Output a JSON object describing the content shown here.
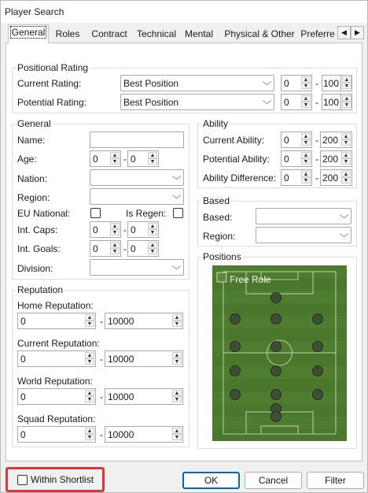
{
  "window": {
    "title": "Player Search"
  },
  "tabs": [
    {
      "label": "General",
      "active": true
    },
    {
      "label": "Roles"
    },
    {
      "label": "Contract"
    },
    {
      "label": "Technical"
    },
    {
      "label": "Mental"
    },
    {
      "label": "Physical & Other"
    },
    {
      "label": "Preferre"
    }
  ],
  "positional_rating": {
    "title": "Positional Rating",
    "current": {
      "label": "Current Rating:",
      "value": "Best Position",
      "min": "0",
      "max": "100"
    },
    "potential": {
      "label": "Potential Rating:",
      "value": "Best Position",
      "min": "0",
      "max": "100"
    }
  },
  "general": {
    "title": "General",
    "name_label": "Name:",
    "age": {
      "label": "Age:",
      "min": "0",
      "max": "0"
    },
    "nation_label": "Nation:",
    "region_label": "Region:",
    "eu_label": "EU National:",
    "regen_label": "Is Regen:",
    "caps": {
      "label": "Int. Caps:",
      "min": "0",
      "max": "0"
    },
    "goals": {
      "label": "Int. Goals:",
      "min": "0",
      "max": "0"
    },
    "division_label": "Division:"
  },
  "ability": {
    "title": "Ability",
    "current": {
      "label": "Current Ability:",
      "min": "0",
      "max": "200"
    },
    "potential": {
      "label": "Potential Ability:",
      "min": "0",
      "max": "200"
    },
    "difference": {
      "label": "Ability Difference:",
      "min": "0",
      "max": "200"
    }
  },
  "based": {
    "title": "Based",
    "based_label": "Based:",
    "region_label": "Region:"
  },
  "positions": {
    "title": "Positions",
    "free_role_label": "Free Role"
  },
  "reputation": {
    "title": "Reputation",
    "home": {
      "label": "Home Reputation:",
      "min": "0",
      "max": "10000"
    },
    "current": {
      "label": "Current Reputation:",
      "min": "0",
      "max": "10000"
    },
    "world": {
      "label": "World Reputation:",
      "min": "0",
      "max": "10000"
    },
    "squad": {
      "label": "Squad Reputation:",
      "min": "0",
      "max": "10000"
    }
  },
  "footer": {
    "shortlist_label": "Within Shortlist",
    "ok_label": "OK",
    "cancel_label": "Cancel",
    "filter_label": "Filter"
  },
  "colors": {
    "highlight": "#d9373a",
    "default_button": "#0067c0",
    "pitch": "#4f7d2f"
  }
}
